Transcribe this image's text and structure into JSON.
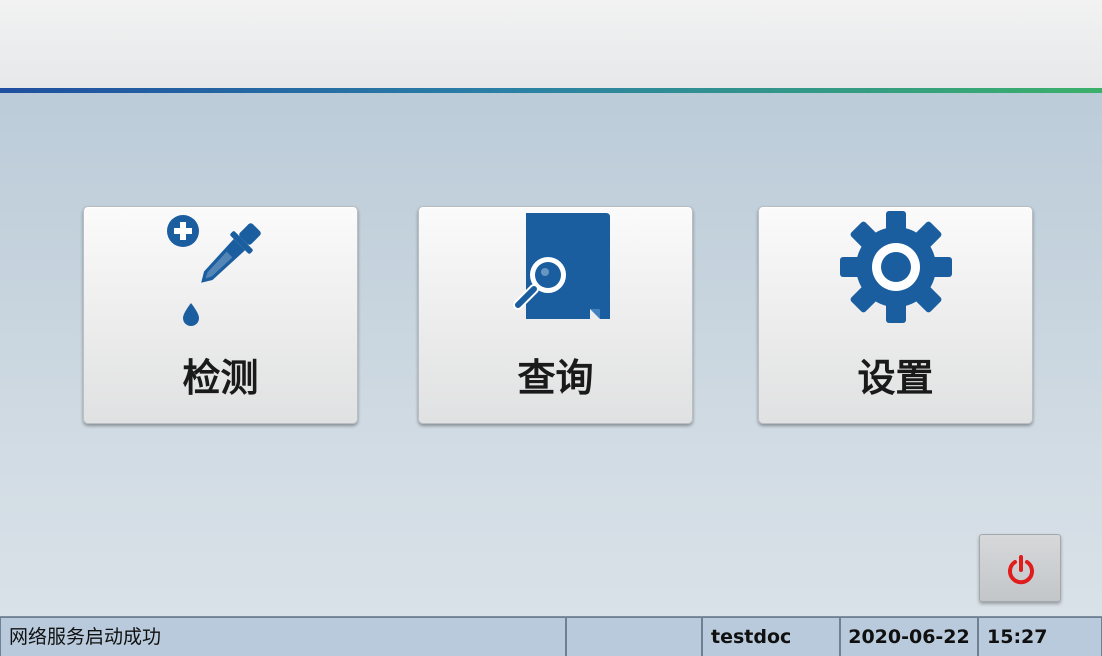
{
  "main": {
    "tiles": [
      {
        "id": "detect",
        "label": "检测",
        "icon": "dropper-plus-icon"
      },
      {
        "id": "query",
        "label": "查询",
        "icon": "document-search-icon"
      },
      {
        "id": "settings",
        "label": "设置",
        "icon": "gear-icon"
      }
    ]
  },
  "power": {
    "icon": "power-icon"
  },
  "statusbar": {
    "message": "网络服务启动成功",
    "user": "testdoc",
    "date": "2020-06-22",
    "time": "15:27"
  },
  "colors": {
    "icon_blue": "#1a5e9f",
    "power_red": "#e01c1c",
    "accent_line_start": "#1f4fa0",
    "accent_line_end": "#3bb06a",
    "statusbar_bg": "#b8cadb"
  }
}
